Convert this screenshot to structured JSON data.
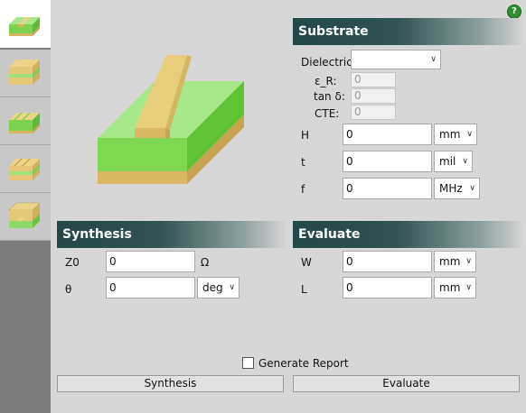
{
  "help": {
    "label": "?"
  },
  "sidebar": {
    "items": [
      {
        "name": "microstrip",
        "active": true
      },
      {
        "name": "stripline",
        "active": false
      },
      {
        "name": "coupled-microstrip",
        "active": false
      },
      {
        "name": "coupled-stripline",
        "active": false
      },
      {
        "name": "enclosed-microstrip",
        "active": false
      }
    ]
  },
  "substrate": {
    "title": "Substrate",
    "dielectric": {
      "label": "Dielectric",
      "value": ""
    },
    "er": {
      "label": "ε_R:",
      "value": "0"
    },
    "tand": {
      "label": "tan δ:",
      "value": "0"
    },
    "cte": {
      "label": "CTE:",
      "value": "0"
    },
    "H": {
      "label": "H",
      "value": "0",
      "unit": "mm"
    },
    "t": {
      "label": "t",
      "value": "0",
      "unit": "mil"
    },
    "f": {
      "label": "f",
      "value": "0",
      "unit": "MHz"
    }
  },
  "synthesis": {
    "title": "Synthesis",
    "z0": {
      "label": "Z0",
      "value": "0",
      "unit": "Ω"
    },
    "theta": {
      "label": "θ",
      "value": "0",
      "unit": "deg"
    }
  },
  "evaluate": {
    "title": "Evaluate",
    "W": {
      "label": "W",
      "value": "0",
      "unit": "mm"
    },
    "L": {
      "label": "L",
      "value": "0",
      "unit": "mm"
    }
  },
  "report": {
    "label": "Generate Report",
    "checked": false
  },
  "buttons": {
    "synthesis": "Synthesis",
    "evaluate": "Evaluate"
  },
  "colors": {
    "header_dark": "#234848",
    "substrate_green": "#79d64e",
    "strip_tan": "#e8cd7c",
    "ground_tan": "#d9b764"
  }
}
